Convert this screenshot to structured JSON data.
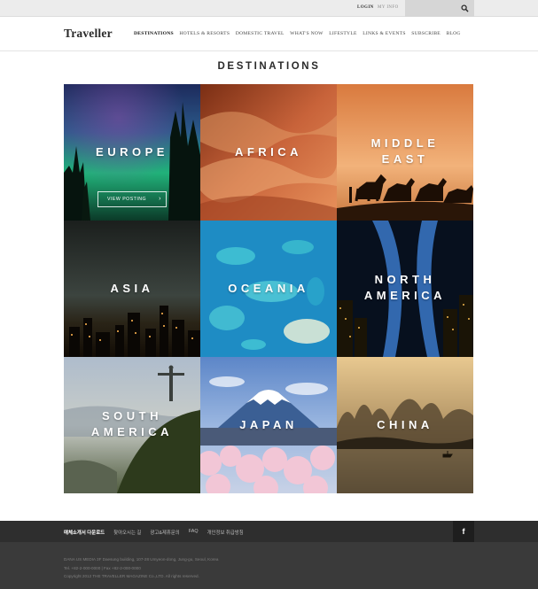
{
  "topbar": {
    "login_label": "LOGIN",
    "mypage_label": "MY INFO",
    "search_placeholder": ""
  },
  "header": {
    "logo": "Traveller",
    "nav": [
      "DESTINATIONS",
      "HOTELS & RESORTS",
      "DOMESTIC TRAVEL",
      "WHAT'S NOW",
      "LIFESTYLE",
      "LINKS & EVENTS",
      "SUBSCRIBE",
      "BLOG"
    ],
    "active_nav": "DESTINATIONS"
  },
  "page": {
    "title": "DESTINATIONS"
  },
  "destinations": [
    {
      "label": "EUROPE",
      "cta": "VIEW POSTING"
    },
    {
      "label": "AFRICA"
    },
    {
      "label": "MIDDLE\nEAST"
    },
    {
      "label": "ASIA"
    },
    {
      "label": "OCEANIA"
    },
    {
      "label": "NORTH\nAMERICA"
    },
    {
      "label": "SOUTH\nAMERICA"
    },
    {
      "label": "JAPAN"
    },
    {
      "label": "CHINA"
    }
  ],
  "footer": {
    "links": [
      "매체소개서 다운로드",
      "찾아오시는 길",
      "광고&제휴문의",
      "FAQ",
      "개인정보 취급방침"
    ],
    "facebook_label": "f",
    "info_lines": [
      "DANA US MEDIA 3F Daesung building, 107-28 Umyeon-dong, Jung-gu, Seoul, Korea",
      "Tel. +82-2-000-0000 | Fax +82-2-000-0000",
      "Copyright 2012 THE TRAVELLER MAGAZINE Co.,LTD. All rights reserved."
    ]
  },
  "colors": {
    "topbar": "#ececec",
    "footer_dark": "#2e2e2e",
    "footer_darker": "#3a3a3a",
    "text_white": "#ffffff"
  }
}
